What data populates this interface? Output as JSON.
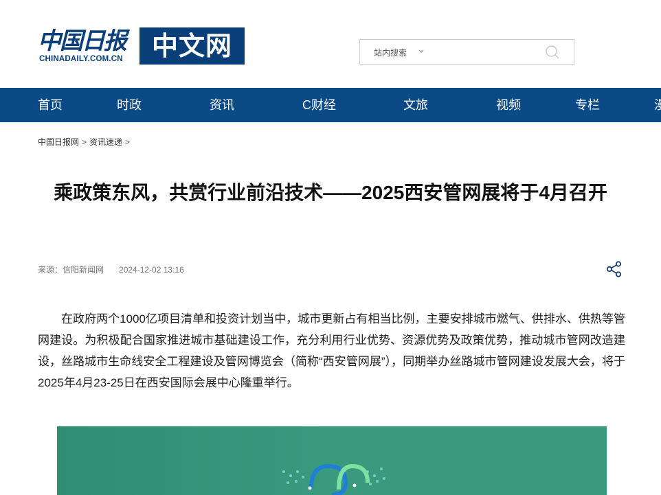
{
  "header": {
    "logo_cn": "中国日报",
    "logo_en": "CHINADAILY.COM.CN",
    "logo_right": "中文网"
  },
  "search": {
    "scope_label": "站内搜索",
    "input_value": "",
    "placeholder": ""
  },
  "nav": {
    "items": [
      {
        "label": "首页"
      },
      {
        "label": "时政"
      },
      {
        "label": "资讯"
      },
      {
        "label": "C财经"
      },
      {
        "label": "文旅"
      },
      {
        "label": "视频"
      },
      {
        "label": "专栏"
      },
      {
        "label": "漫"
      }
    ]
  },
  "breadcrumb": {
    "items": [
      "中国日报网",
      "资讯速递"
    ],
    "separator": ">"
  },
  "article": {
    "title": "乘政策东风，共赏行业前沿技术——2025西安管网展将于4月召开",
    "source": "来源：信阳新闻网",
    "time": "2024-12-02 13:16",
    "body": "在政府两个1000亿项目清单和投资计划当中，城市更新占有相当比例，主要安排城市燃气、供排水、供热等管网建设。为积极配合国家推进城市基础建设工作，充分利用行业优势、资源优势及政策优势，推动城市管网改造建设，丝路城市生命线安全工程建设及管网博览会（简称“西安管网展”），同期举办丝路城市管网建设发展大会，将于2025年4月23-25日在西安国际会展中心隆重举行。"
  },
  "colors": {
    "brand_blue": "#0a3f7a",
    "nav_blue": "#0b4a87",
    "image_green": "#3a9a7e"
  },
  "icons": {
    "search": "search-icon",
    "chevron": "chevron-down-icon",
    "share": "share-icon"
  }
}
